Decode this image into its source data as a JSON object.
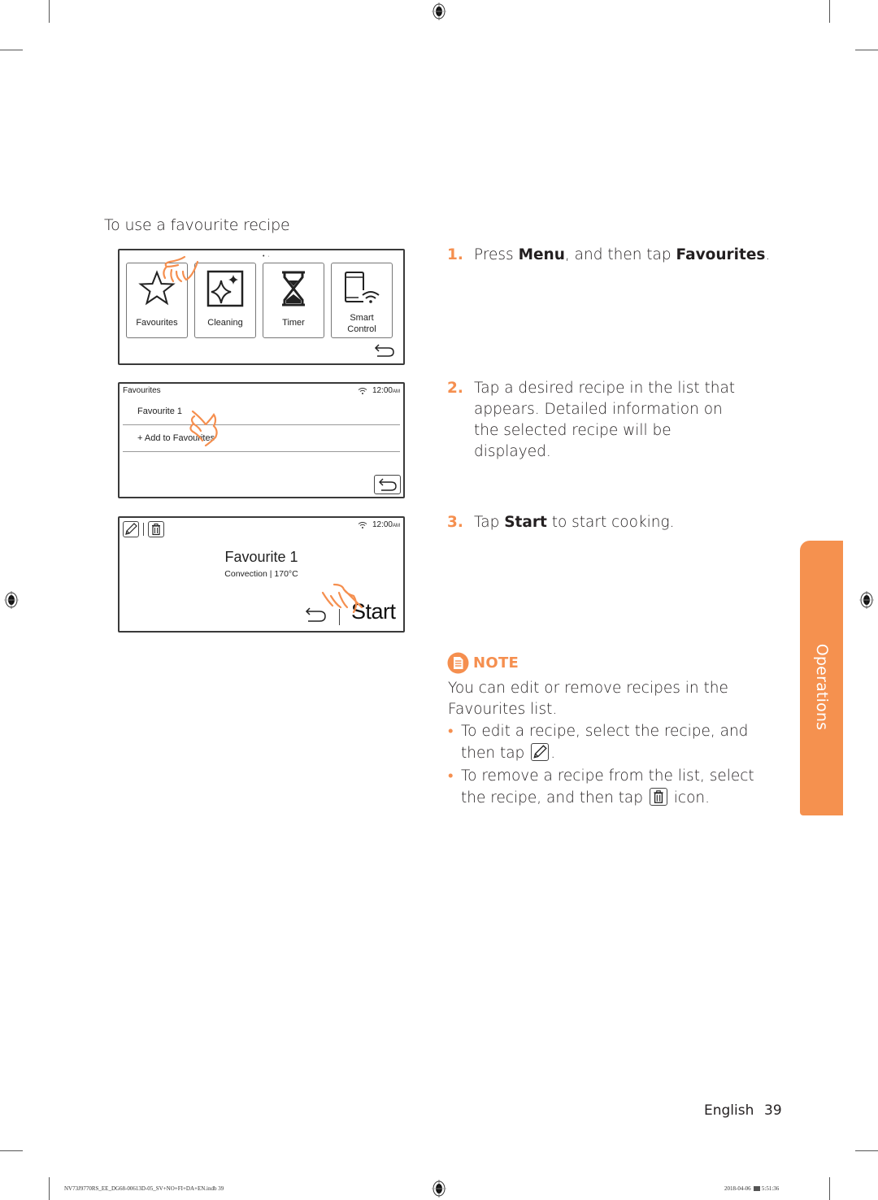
{
  "section_title": "To use a favourite recipe",
  "screen1": {
    "page_indicator": "• ·",
    "tiles": [
      {
        "label": "Favourites",
        "icon": "star-icon"
      },
      {
        "label": "Cleaning",
        "icon": "sparkle-icon"
      },
      {
        "label": "Timer",
        "icon": "hourglass-icon"
      },
      {
        "label_line1": "Smart",
        "label_line2": "Control",
        "icon": "smartphone-wifi-icon"
      }
    ],
    "back_icon": "back-arrow-icon"
  },
  "screen2": {
    "title": "Favourites",
    "time": "12:00",
    "ampm": "AM",
    "rows": [
      {
        "label": "Favourite 1"
      },
      {
        "label": "+  Add to Favourites"
      }
    ],
    "back_icon": "back-arrow-icon"
  },
  "screen3": {
    "time": "12:00",
    "ampm": "AM",
    "recipe_name": "Favourite 1",
    "recipe_info": "Convection | 170°C",
    "start_label": "Start",
    "edit_icon": "pencil-icon",
    "delete_icon": "trash-icon"
  },
  "steps": [
    {
      "num": "1.",
      "pre": "Press ",
      "b1": "Menu",
      "mid": ", and then tap ",
      "b2": "Favourites",
      "post": "."
    },
    {
      "num": "2.",
      "text": "Tap a desired recipe in the list that appears. Detailed information on the selected recipe will be displayed."
    },
    {
      "num": "3.",
      "pre": "Tap ",
      "b1": "Start",
      "post": " to start cooking."
    }
  ],
  "note": {
    "label": "NOTE",
    "intro": "You can edit or remove recipes in the Favourites list.",
    "bullets": [
      {
        "pre": "To edit a recipe, select the recipe, and then tap ",
        "post": "."
      },
      {
        "pre": "To remove a recipe from the list, select the recipe, and then tap ",
        "post": " icon."
      }
    ]
  },
  "side_tab": {
    "label": "Operations",
    "color": "#f5914f"
  },
  "footer": {
    "language": "English",
    "page": "39"
  },
  "print_info": {
    "file": "NV73J9770RS_EE_DG68-00613D-05_SV+NO+FI+DA+EN.indb   39",
    "date": "2018-04-06",
    "time": "5:51:36"
  },
  "accent_color": "#f58f4f"
}
